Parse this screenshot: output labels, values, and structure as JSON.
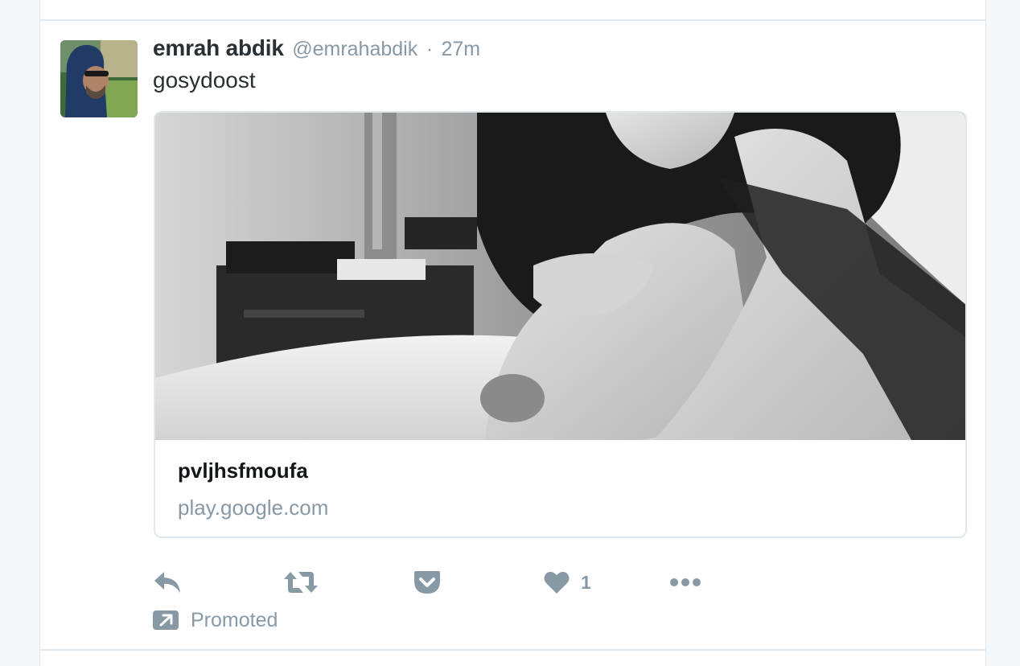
{
  "tweet": {
    "author_name": "emrah abdik",
    "author_handle": "@emrahabdik",
    "separator": "·",
    "timestamp": "27m",
    "text": "gosydoost"
  },
  "card": {
    "title": "pvljhsfmoufa",
    "domain": "play.google.com"
  },
  "actions": {
    "reply_icon": "reply-icon",
    "retweet_icon": "retweet-icon",
    "pocket_icon": "pocket-icon",
    "like_icon": "heart-icon",
    "like_count": "1",
    "more_icon": "more-dots-icon"
  },
  "promoted": {
    "label": "Promoted",
    "icon": "promoted-arrow-icon"
  },
  "colors": {
    "text_primary": "#292f33",
    "text_secondary": "#8899a6",
    "border": "#e1e8ed",
    "page_background": "#f5f8fa"
  }
}
